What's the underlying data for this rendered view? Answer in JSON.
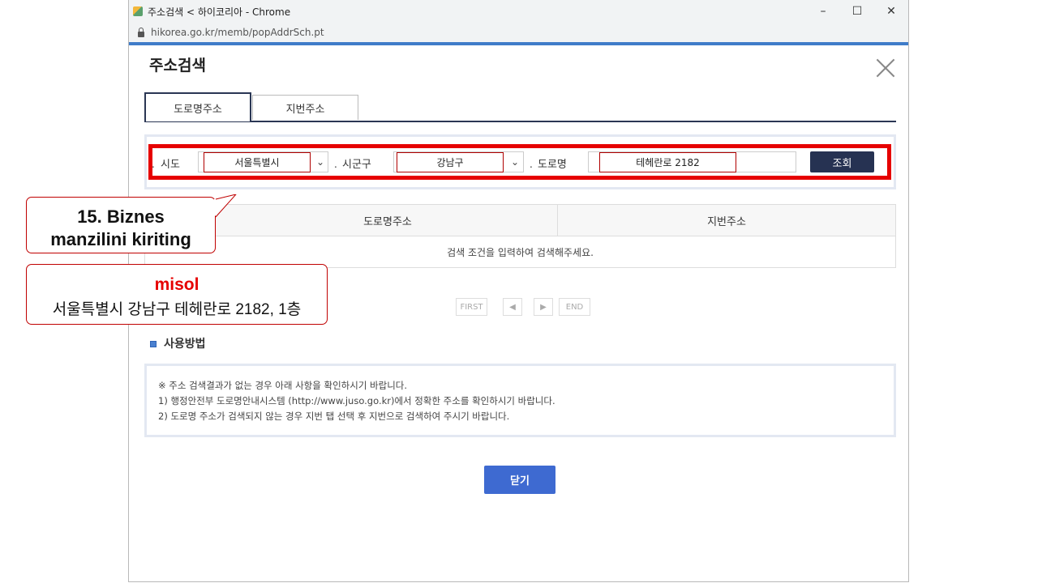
{
  "browser": {
    "window_title": "주소검색 < 하이코리아 - Chrome",
    "url": "hikorea.go.kr/memb/popAddrSch.pt",
    "controls": {
      "minimize": "–",
      "maximize": "☐",
      "close": "✕"
    }
  },
  "popup": {
    "title": "주소검색",
    "tabs": [
      {
        "label": "도로명주소",
        "active": true
      },
      {
        "label": "지번주소",
        "active": false
      }
    ],
    "search": {
      "sido_label": "시도",
      "sido_value": "서울특별시",
      "sigungu_label": "시군구",
      "sigungu_value": "강남구",
      "road_label": "도로명",
      "road_value": "테헤란로 2182",
      "dot": ".",
      "search_button": "조회"
    },
    "results": {
      "columns": [
        "도로명주소",
        "지번주소"
      ],
      "empty_message": "검색 조건을 입력하여 검색해주세요."
    },
    "pagination": {
      "first": "FIRST",
      "prev": "◀",
      "next": "▶",
      "end": "END"
    },
    "howto": {
      "title": "사용방법",
      "lines": [
        "※ 주소 검색결과가 없는 경우 아래 사항을 확인하시기 바랍니다.",
        "1) 행정안전부 도로명안내시스템 (http://www.juso.go.kr)에서 정확한 주소를 확인하시기 바랍니다.",
        "2) 도로명 주소가 검색되지 않는 경우 지번 탭 선택 후 지번으로 검색하여 주시기 바랍니다."
      ]
    },
    "close_button": "닫기"
  },
  "annotations": {
    "step_line1": "15. Biznes",
    "step_line2": "manzilini kiriting",
    "example_keyword": "misol",
    "example_text": "서울특별시 강남구 테헤란로 2182, 1층"
  },
  "colors": {
    "highlight_red": "#e60000",
    "navy": "#263252",
    "button_blue": "#3e6ad1",
    "header_blue": "#3f7cc9"
  }
}
